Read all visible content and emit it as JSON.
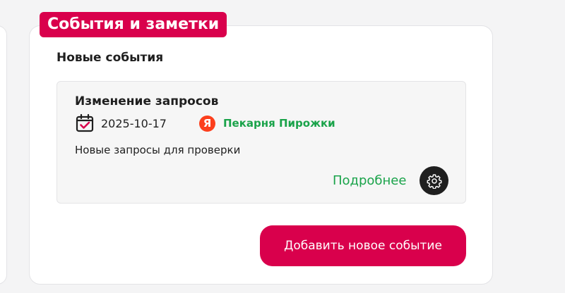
{
  "panel": {
    "tag": "События и заметки",
    "section_title": "Новые события",
    "add_button": "Добавить новое событие"
  },
  "event": {
    "title": "Изменение запросов",
    "date": "2025-10-17",
    "source_logo_letter": "Я",
    "source_name": "Пекарня Пирожки",
    "description": "Новые запросы для проверки",
    "details_link": "Подробнее"
  },
  "icons": {
    "calendar": "calendar-check-icon",
    "source": "yandex-logo-icon",
    "settings": "gear-icon"
  },
  "colors": {
    "brand_accent": "#d9004c",
    "link_green": "#1aa34a",
    "yandex_red": "#fc3f1d"
  }
}
